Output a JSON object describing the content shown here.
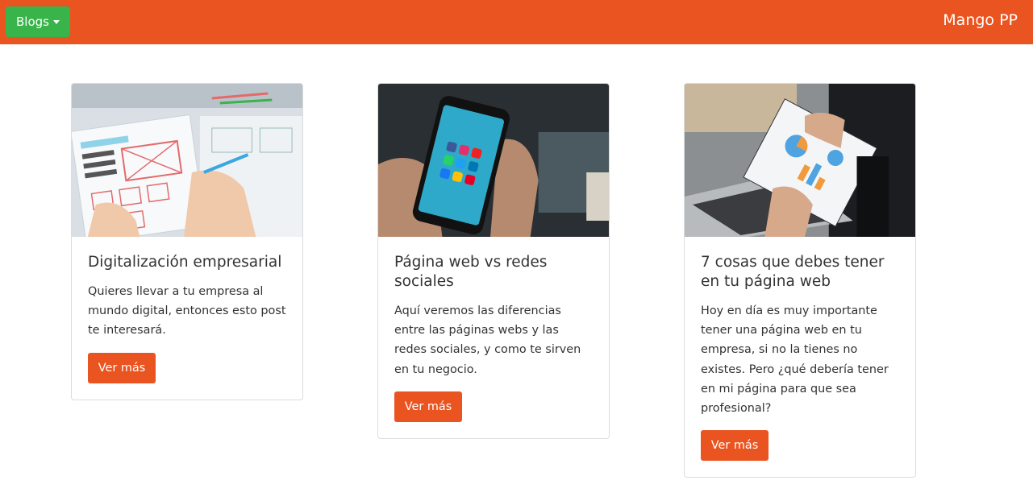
{
  "navbar": {
    "dropdown_label": "Blogs",
    "brand": "Mango PP",
    "colors": {
      "navbar_bg": "#e95420",
      "dropdown_bg": "#38b44a"
    }
  },
  "cards": [
    {
      "title": "Digitalización empresarial",
      "text": "Quieres llevar a tu empresa al mundo digital, entonces esto post te interesará.",
      "button": "Ver más",
      "image": "website-wireframe-sketching-photo"
    },
    {
      "title": "Página web vs redes sociales",
      "text": "Aquí veremos las diferencias entre las páginas webs y las redes sociales, y como te sirven en tu negocio.",
      "button": "Ver más",
      "image": "smartphone-social-media-photo"
    },
    {
      "title": "7 cosas que debes tener en tu página web",
      "text": "Hoy en día es muy importante tener una página web en tu empresa, si no la tienes no existes. Pero ¿qué debería tener en mi página para que sea profesional?",
      "button": "Ver más",
      "image": "business-charts-laptop-photo"
    }
  ],
  "colors": {
    "accent": "#e95420",
    "success": "#38b44a"
  }
}
